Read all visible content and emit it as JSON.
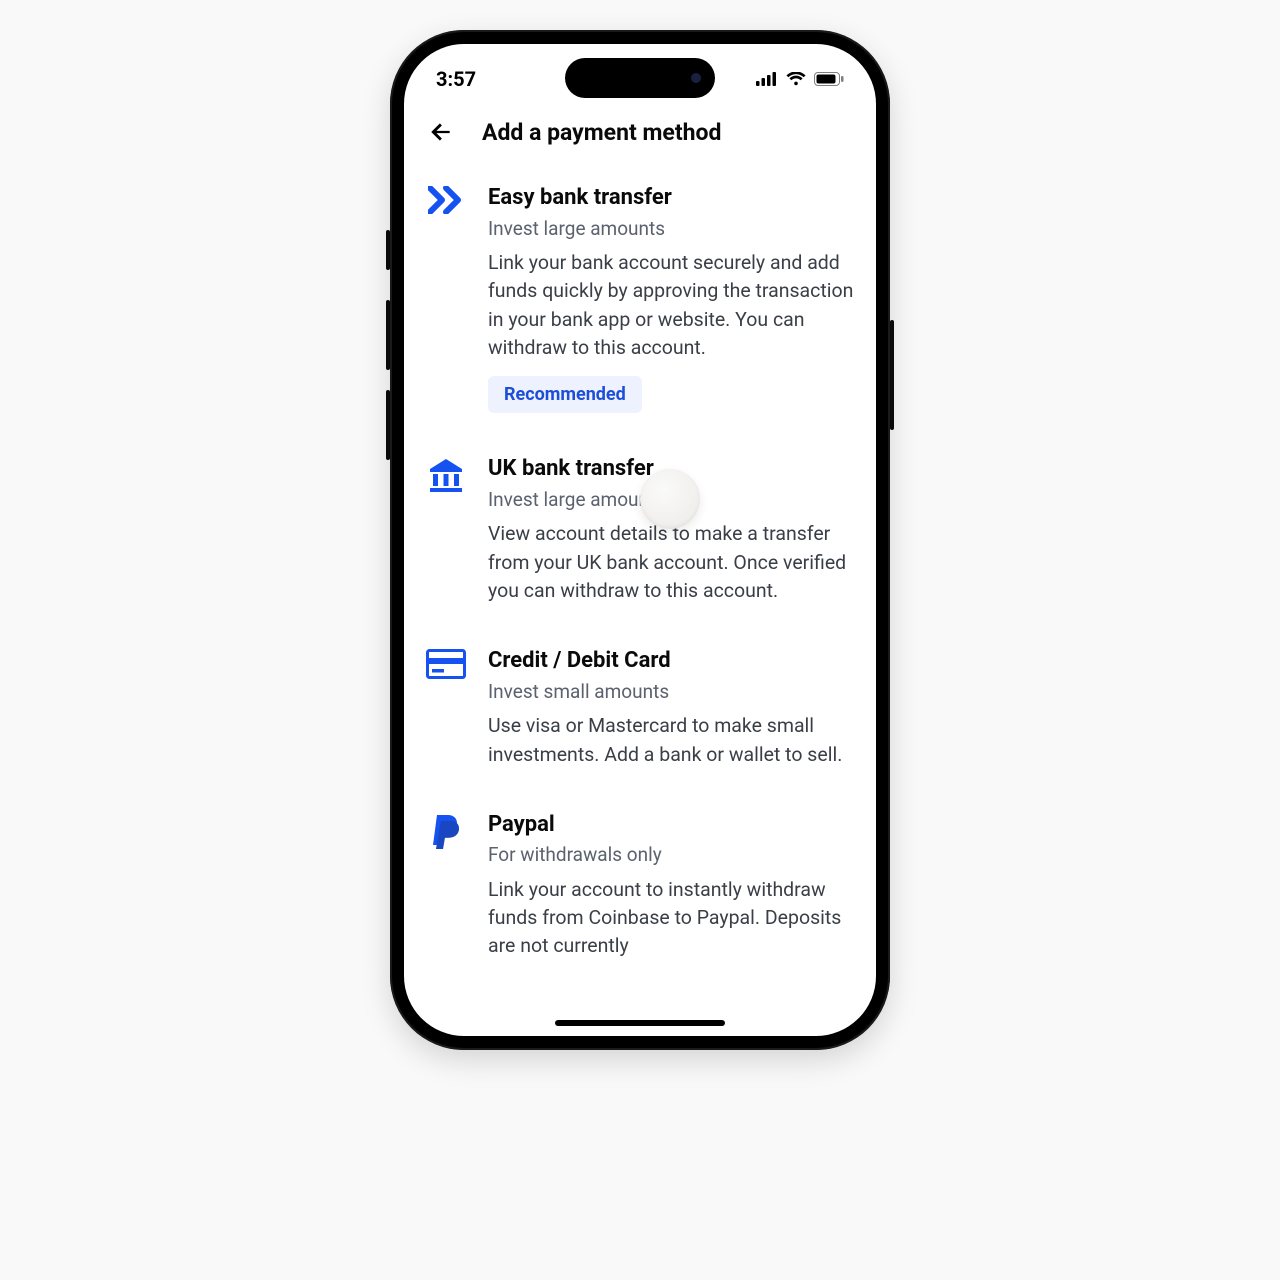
{
  "status": {
    "time": "3:57"
  },
  "header": {
    "title": "Add a payment method"
  },
  "items": [
    {
      "title": "Easy bank transfer",
      "subtitle": "Invest large amounts",
      "description": "Link your bank account securely and add funds quickly by approving the transaction in your bank app or website. You can withdraw to this account.",
      "badge": "Recommended"
    },
    {
      "title": "UK bank transfer",
      "subtitle": "Invest large amounts",
      "description": "View account details to make a transfer from your UK bank account. Once verified you can withdraw to this account."
    },
    {
      "title": "Credit / Debit Card",
      "subtitle": "Invest small amounts",
      "description": "Use visa or Mastercard to make small investments. Add a bank or wallet to sell."
    },
    {
      "title": "Paypal",
      "subtitle": "For withdrawals only",
      "description": "Link your account to instantly withdraw funds from Coinbase to Paypal. Deposits are not currently"
    }
  ],
  "colors": {
    "accent": "#1652f0"
  }
}
